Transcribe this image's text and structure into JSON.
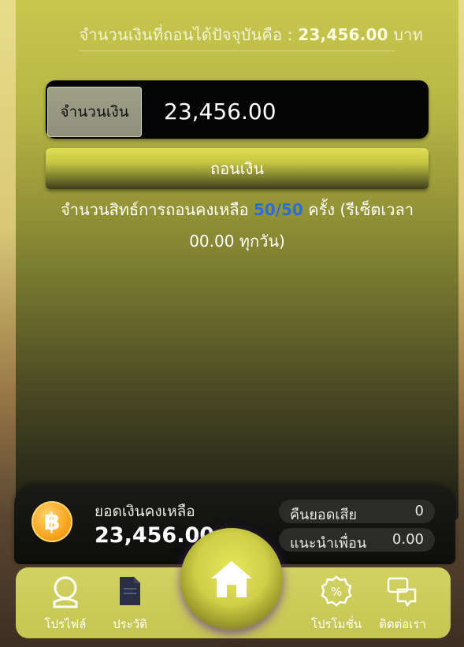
{
  "header": {
    "available_label": "จำนวนเงินที่ถอนได้ปัจจุบันคือ :",
    "available_amount": "23,456.00",
    "currency": "บาท"
  },
  "withdraw_form": {
    "amount_label": "จำนวนเงิน",
    "amount_value": "23,456.00",
    "withdraw_button": "ถอนเงิน"
  },
  "rights": {
    "prefix": "จำนวนสิทธ์การถอนคงเหลือ",
    "count": "50/50",
    "suffix": "ครั้ง (รีเซ็ตเวลา 00.00 ทุกวัน)"
  },
  "balance_card": {
    "coin_symbol": "฿",
    "balance_label": "ยอดเงินคงเหลือ",
    "balance_value": "23,456.00",
    "cashback_label": "คืนยอดเสีย",
    "cashback_value": "0",
    "referral_label": "แนะนำเพื่อน",
    "referral_value": "0.00"
  },
  "bottom_nav": {
    "profile": "โปรไฟล์",
    "history": "ประวัติ",
    "promotion": "โปรโมชั่น",
    "contact": "ติดต่อเรา",
    "home_icon": "home-icon"
  }
}
